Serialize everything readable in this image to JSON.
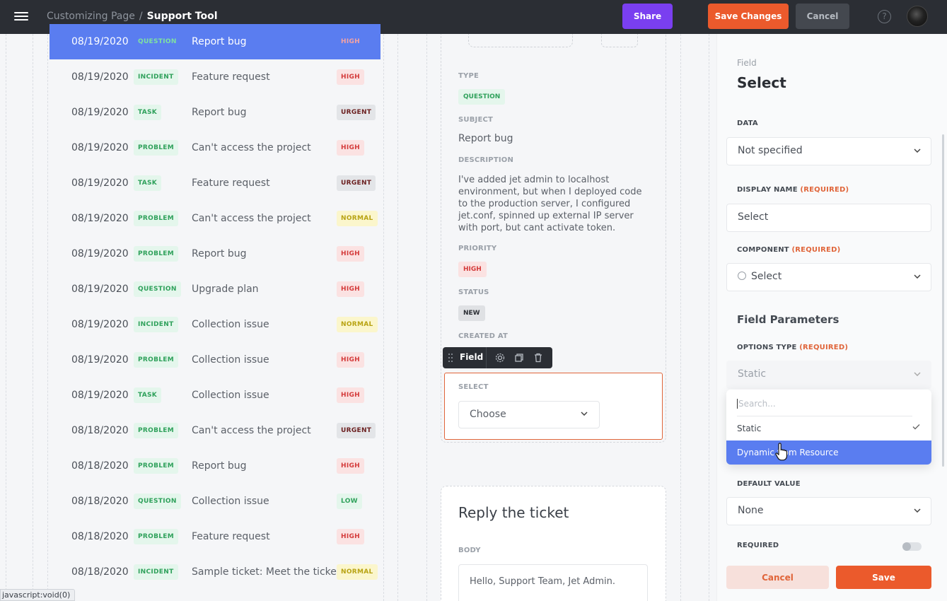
{
  "header": {
    "breadcrumb_parent": "Customizing Page",
    "breadcrumb_separator": "/",
    "breadcrumb_current": "Support Tool",
    "share_label": "Share",
    "save_changes_label": "Save Changes",
    "cancel_label": "Cancel",
    "help_symbol": "?"
  },
  "tickets": [
    {
      "date": "08/19/2020",
      "type": "QUESTION",
      "subject": "Report bug",
      "priority": "HIGH",
      "selected": true
    },
    {
      "date": "08/19/2020",
      "type": "INCIDENT",
      "subject": "Feature request",
      "priority": "HIGH"
    },
    {
      "date": "08/19/2020",
      "type": "TASK",
      "subject": "Report bug",
      "priority": "URGENT"
    },
    {
      "date": "08/19/2020",
      "type": "PROBLEM",
      "subject": "Can't access the project",
      "priority": "HIGH"
    },
    {
      "date": "08/19/2020",
      "type": "TASK",
      "subject": "Feature request",
      "priority": "URGENT"
    },
    {
      "date": "08/19/2020",
      "type": "PROBLEM",
      "subject": "Can't access the project",
      "priority": "NORMAL"
    },
    {
      "date": "08/19/2020",
      "type": "PROBLEM",
      "subject": "Report bug",
      "priority": "HIGH"
    },
    {
      "date": "08/19/2020",
      "type": "QUESTION",
      "subject": "Upgrade plan",
      "priority": "HIGH"
    },
    {
      "date": "08/19/2020",
      "type": "INCIDENT",
      "subject": "Collection issue",
      "priority": "NORMAL"
    },
    {
      "date": "08/19/2020",
      "type": "PROBLEM",
      "subject": "Collection issue",
      "priority": "HIGH"
    },
    {
      "date": "08/19/2020",
      "type": "TASK",
      "subject": "Collection issue",
      "priority": "HIGH"
    },
    {
      "date": "08/18/2020",
      "type": "PROBLEM",
      "subject": "Can't access the project",
      "priority": "URGENT"
    },
    {
      "date": "08/18/2020",
      "type": "PROBLEM",
      "subject": "Report bug",
      "priority": "HIGH"
    },
    {
      "date": "08/18/2020",
      "type": "QUESTION",
      "subject": "Collection issue",
      "priority": "LOW"
    },
    {
      "date": "08/18/2020",
      "type": "PROBLEM",
      "subject": "Feature request",
      "priority": "HIGH"
    },
    {
      "date": "08/18/2020",
      "type": "INCIDENT",
      "subject": "Sample ticket: Meet the ticket",
      "priority": "NORMAL"
    }
  ],
  "detail": {
    "type_label": "TYPE",
    "type_value": "QUESTION",
    "subject_label": "SUBJECT",
    "subject_value": "Report bug",
    "description_label": "DESCRIPTION",
    "description_value": "I've added jet admin to localhost environment, but when I deployed code to the production server, I configured jet.conf, spinned up external IP server with port, but cant activate token.",
    "priority_label": "PRIORITY",
    "priority_value": "HIGH",
    "status_label": "STATUS",
    "status_value": "NEW",
    "created_label": "CREATED AT",
    "field_toolbar_label": "Field",
    "select_label": "SELECT",
    "select_value": "Choose"
  },
  "reply": {
    "title": "Reply the ticket",
    "body_label": "BODY",
    "body_value": "Hello, Support Team, Jet Admin."
  },
  "panel": {
    "kind": "Field",
    "title": "Select",
    "data_label": "DATA",
    "data_value": "Not specified",
    "display_name_label": "DISPLAY NAME",
    "required_text": "(REQUIRED)",
    "display_name_value": "Select",
    "component_label": "COMPONENT",
    "component_value": "Select",
    "section_title": "Field Parameters",
    "options_type_label": "OPTIONS TYPE",
    "options_type_value": "Static",
    "search_placeholder": "Search...",
    "options": [
      "Static",
      "Dynamic from Resource"
    ],
    "default_value_label": "DEFAULT VALUE",
    "default_value": "None",
    "required_label": "REQUIRED",
    "cancel_label": "Cancel",
    "save_label": "Save"
  },
  "status_bar": "javascript:void(0)",
  "colors": {
    "accent": "#eb5a2c",
    "share": "#7a3ff0",
    "selection": "#5a7df0",
    "topbar": "#2b2e34"
  }
}
